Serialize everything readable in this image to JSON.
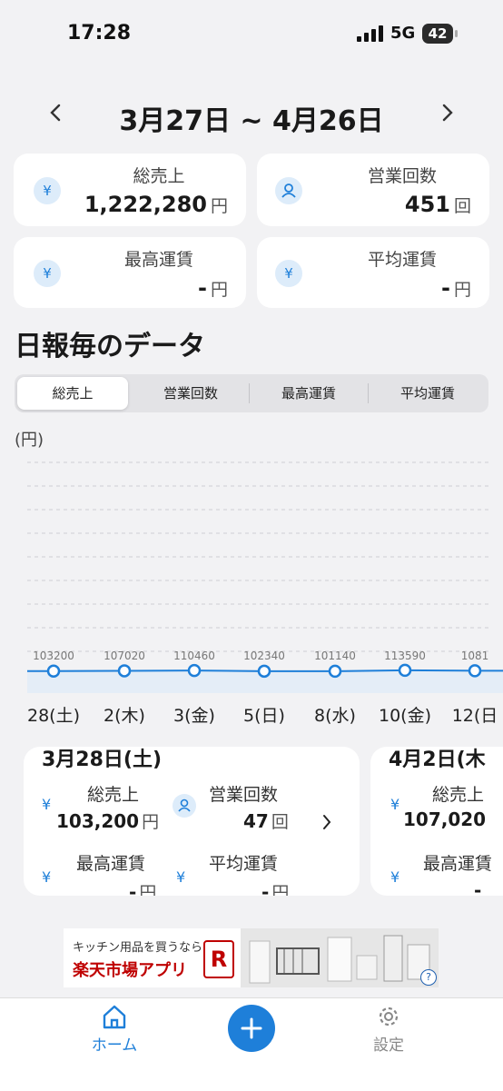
{
  "status_bar": {
    "time": "17:28",
    "network": "5G",
    "battery": "42"
  },
  "header": {
    "prev_icon": "chevron-left-icon",
    "next_icon": "chevron-right-icon",
    "date_range": "3月27日 ~ 4月26日"
  },
  "summary": {
    "total_sales": {
      "label": "総売上",
      "value": "1,222,280",
      "unit": "円",
      "icon": "yen-icon"
    },
    "trip_count": {
      "label": "営業回数",
      "value": "451",
      "unit": "回",
      "icon": "person-icon"
    },
    "max_fare": {
      "label": "最高運賃",
      "value": "-",
      "unit": "円",
      "icon": "yen-icon"
    },
    "avg_fare": {
      "label": "平均運賃",
      "value": "-",
      "unit": "円",
      "icon": "yen-icon"
    }
  },
  "section_title": "日報毎のデータ",
  "tabs": [
    "総売上",
    "営業回数",
    "最高運賃",
    "平均運賃"
  ],
  "active_tab": 0,
  "unit_label": "(円)",
  "chart_data": {
    "type": "line",
    "x": [
      "28(土)",
      "2(木)",
      "3(金)",
      "5(日)",
      "8(水)",
      "10(金)",
      "12(日"
    ],
    "value_labels": [
      "103200",
      "107020",
      "110460",
      "102340",
      "101140",
      "113590",
      "1081"
    ],
    "series": [
      {
        "values": [
          103200,
          107020,
          110460,
          102340,
          101140,
          113590,
          108100
        ]
      }
    ],
    "ylabel": "(円)",
    "grid": true,
    "color": "#1e7fd9"
  },
  "day_cards": [
    {
      "date": "3月28日(土)",
      "total_sales_label": "総売上",
      "total_sales": "103,200",
      "yen_unit": "円",
      "trip_count_label": "営業回数",
      "trip_count": "47",
      "count_unit": "回",
      "max_fare_label": "最高運賃",
      "max_fare": "-",
      "avg_fare_label": "平均運賃",
      "avg_fare": "-"
    },
    {
      "date": "4月2日(木",
      "total_sales_label": "総売上",
      "total_sales": "107,020",
      "max_fare_label": "最高運賃",
      "max_fare": "-"
    }
  ],
  "ad": {
    "line1": "キッチン用品を買うなら",
    "line2": "楽天市場アプリ",
    "logo": "R"
  },
  "tab_bar": {
    "home": "ホーム",
    "settings": "設定"
  },
  "colors": {
    "accent": "#1e7fd9",
    "background": "#f2f2f4",
    "card": "#ffffff",
    "rakuten": "#bf0000"
  }
}
